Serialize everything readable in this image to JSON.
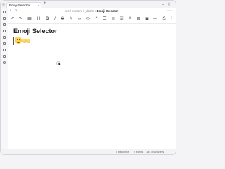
{
  "tab": {
    "title": "Emoji Selector",
    "close_icon": "×",
    "add_icon": "+"
  },
  "breadcrumb": {
    "path": [
      "src",
      "content",
      "_drafts"
    ],
    "current": "Emoji Selector",
    "separator": "/"
  },
  "document": {
    "title": "Emoji Selector"
  },
  "statusbar": {
    "backlinks": "0 backlinks",
    "words": "2 words",
    "characters": "134 characters"
  }
}
